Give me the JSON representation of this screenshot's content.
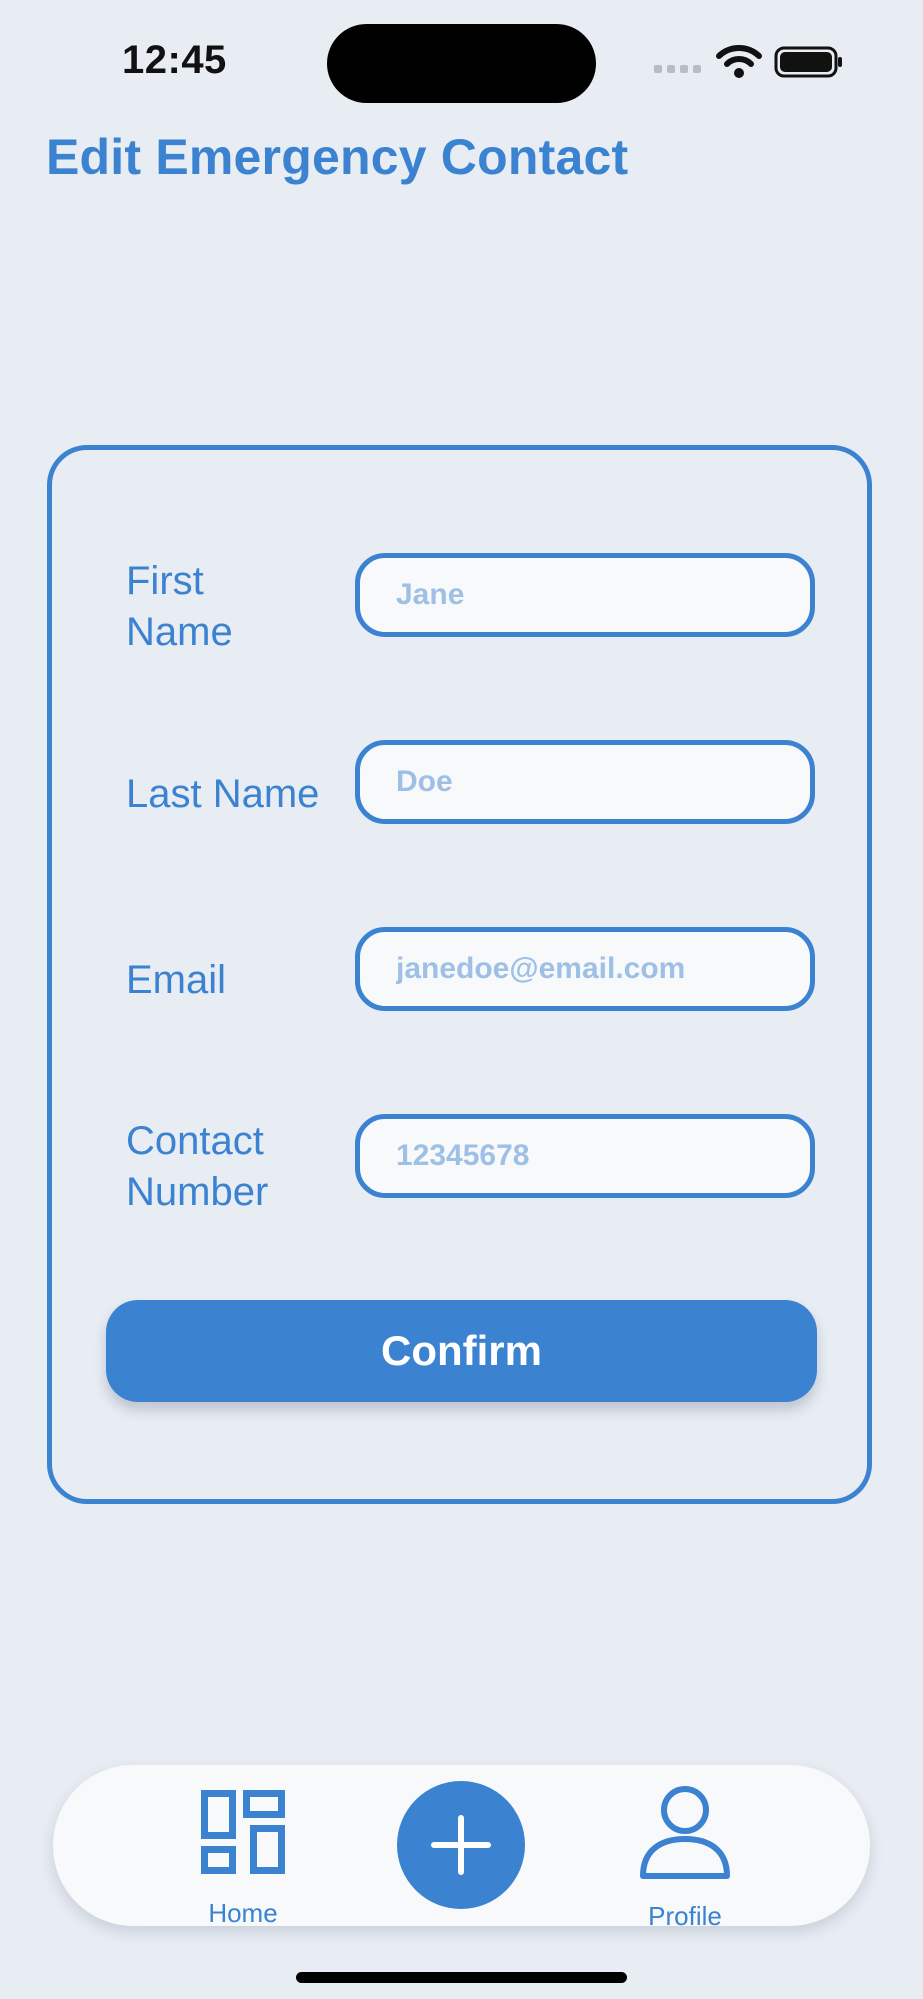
{
  "status_bar": {
    "time": "12:45"
  },
  "header": {
    "title": "Edit Emergency Contact"
  },
  "form": {
    "first_name": {
      "label": "First\nName",
      "placeholder": "Jane",
      "value": ""
    },
    "last_name": {
      "label": "Last Name",
      "placeholder": "Doe",
      "value": ""
    },
    "email": {
      "label": "Email",
      "placeholder": "janedoe@email.com",
      "value": ""
    },
    "contact_number": {
      "label": "Contact\nNumber",
      "placeholder": "12345678",
      "value": ""
    },
    "confirm_label": "Confirm"
  },
  "tab_bar": {
    "items": [
      {
        "label": "Home",
        "icon": "grid-icon"
      },
      {
        "label": "",
        "icon": "plus-icon"
      },
      {
        "label": "Profile",
        "icon": "person-icon"
      }
    ]
  },
  "colors": {
    "accent": "#3b82d1",
    "background": "#e8ecf3",
    "input_background": "#f7f9fb",
    "placeholder": "#9fc0e6"
  }
}
